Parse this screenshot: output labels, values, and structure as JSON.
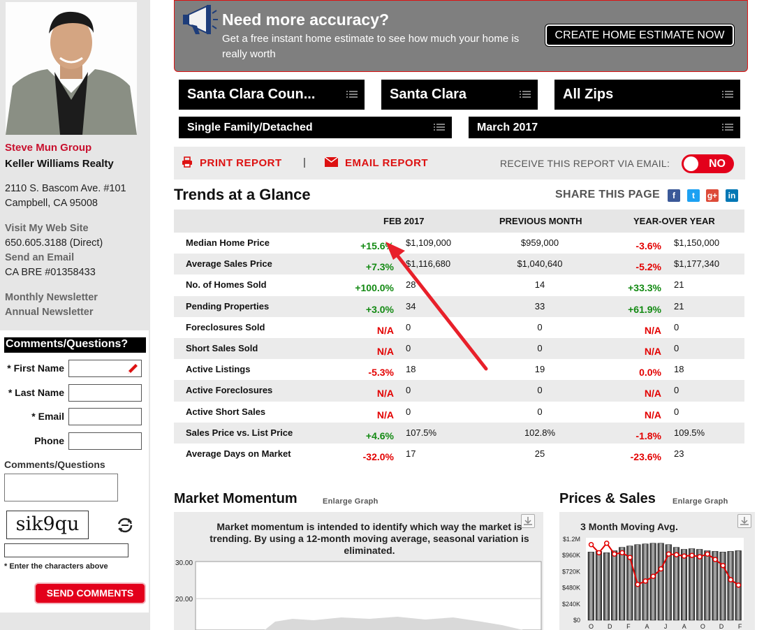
{
  "agent": {
    "name": "Steve Mun Group",
    "company": "Keller Williams Realty",
    "address1": "2110 S. Bascom Ave. #101",
    "address2": "Campbell, CA 95008",
    "website_link": "Visit My Web Site",
    "phone": "650.605.3188  (Direct)",
    "email_link": "Send an Email",
    "license": "CA BRE #01358433",
    "monthly_newsletter": "Monthly Newsletter",
    "annual_newsletter": "Annual Newsletter"
  },
  "form": {
    "title": "Comments/Questions?",
    "first_name_label": "* First Name",
    "last_name_label": "* Last Name",
    "email_label": "* Email",
    "phone_label": "Phone",
    "comments_label": "Comments/Questions",
    "captcha_text": "sik9qu",
    "captcha_note": "* Enter the characters above",
    "send_label": "SEND COMMENTS"
  },
  "banner": {
    "title": "Need more accuracy?",
    "subtitle": "Get a free instant home estimate to see how much your home is really worth",
    "button": "CREATE HOME ESTIMATE NOW"
  },
  "filters": {
    "county": "Santa Clara Coun...",
    "city": "Santa Clara",
    "zip": "All Zips",
    "property_type": "Single Family/Detached",
    "month": "March 2017"
  },
  "toolbar": {
    "print": "PRINT REPORT",
    "email": "EMAIL REPORT",
    "receive": "RECEIVE THIS REPORT VIA EMAIL:",
    "toggle": "NO"
  },
  "trends": {
    "title": "Trends at a Glance",
    "share": "SHARE THIS PAGE",
    "social": [
      "f",
      "t",
      "g+",
      "in"
    ],
    "colors": {
      "facebook": "#3b5998",
      "twitter": "#1da1f2",
      "google": "#dd4b39",
      "linkedin": "#0077b5",
      "positive": "#138a13",
      "negative": "#e30000",
      "accent": "#e3001b"
    },
    "headers": {
      "current": "FEB 2017",
      "previous": "PREVIOUS MONTH",
      "yoy": "YEAR-OVER YEAR"
    },
    "rows": [
      {
        "label": "Median Home Price",
        "pct": "+15.6%",
        "pct_type": "pos",
        "value": "$1,109,000",
        "prev": "$959,000",
        "yoy_pct": "-3.6%",
        "yoy_type": "neg",
        "yoy_value": "$1,150,000"
      },
      {
        "label": "Average Sales Price",
        "pct": "+7.3%",
        "pct_type": "pos",
        "value": "$1,116,680",
        "prev": "$1,040,640",
        "yoy_pct": "-5.2%",
        "yoy_type": "neg",
        "yoy_value": "$1,177,340"
      },
      {
        "label": "No. of Homes Sold",
        "pct": "+100.0%",
        "pct_type": "pos",
        "value": "28",
        "prev": "14",
        "yoy_pct": "+33.3%",
        "yoy_type": "pos",
        "yoy_value": "21"
      },
      {
        "label": "Pending Properties",
        "pct": "+3.0%",
        "pct_type": "pos",
        "value": "34",
        "prev": "33",
        "yoy_pct": "+61.9%",
        "yoy_type": "pos",
        "yoy_value": "21"
      },
      {
        "label": "Foreclosures Sold",
        "pct": "N/A",
        "pct_type": "neg",
        "value": "0",
        "prev": "0",
        "yoy_pct": "N/A",
        "yoy_type": "neg",
        "yoy_value": "0"
      },
      {
        "label": "Short Sales Sold",
        "pct": "N/A",
        "pct_type": "neg",
        "value": "0",
        "prev": "0",
        "yoy_pct": "N/A",
        "yoy_type": "neg",
        "yoy_value": "0"
      },
      {
        "label": "Active Listings",
        "pct": "-5.3%",
        "pct_type": "neg",
        "value": "18",
        "prev": "19",
        "yoy_pct": "0.0%",
        "yoy_type": "neg",
        "yoy_value": "18"
      },
      {
        "label": "Active Foreclosures",
        "pct": "N/A",
        "pct_type": "neg",
        "value": "0",
        "prev": "0",
        "yoy_pct": "N/A",
        "yoy_type": "neg",
        "yoy_value": "0"
      },
      {
        "label": "Active Short Sales",
        "pct": "N/A",
        "pct_type": "neg",
        "value": "0",
        "prev": "0",
        "yoy_pct": "N/A",
        "yoy_type": "neg",
        "yoy_value": "0"
      },
      {
        "label": "Sales Price vs. List Price",
        "pct": "+4.6%",
        "pct_type": "pos",
        "value": "107.5%",
        "prev": "102.8%",
        "yoy_pct": "-1.8%",
        "yoy_type": "neg",
        "yoy_value": "109.5%"
      },
      {
        "label": "Average Days on Market",
        "pct": "-32.0%",
        "pct_type": "neg",
        "value": "17",
        "prev": "25",
        "yoy_pct": "-23.6%",
        "yoy_type": "neg",
        "yoy_value": "23"
      }
    ]
  },
  "market_momentum": {
    "title": "Market Momentum",
    "enlarge": "Enlarge Graph",
    "description": "Market momentum is intended to identify which way the market is trending. By using a 12-month moving average, seasonal variation is eliminated.",
    "y_ticks": [
      "30.00",
      "20.00"
    ]
  },
  "prices_sales": {
    "title": "Prices & Sales",
    "enlarge": "Enlarge Graph",
    "subtitle": "3 Month Moving Avg."
  },
  "chart_data": [
    {
      "type": "area",
      "title": "Market Momentum",
      "ylim": [
        0,
        30
      ],
      "y_ticks": [
        20,
        30
      ],
      "grid": true
    },
    {
      "type": "bar",
      "title": "3 Month Moving Avg.",
      "y_ticks": [
        "$0",
        "$240K",
        "$480K",
        "$720K",
        "$960K",
        "$1.2M"
      ],
      "ylim": [
        0,
        1200000
      ],
      "x_ticks": [
        "O",
        "D",
        "F",
        "A",
        "J",
        "A",
        "O",
        "D",
        "F"
      ],
      "series": [
        {
          "values": [
            1010000,
            1020000,
            1000000,
            1030000,
            1080000,
            1100000,
            1120000,
            1130000,
            1140000,
            1140000,
            1120000,
            1080000,
            1050000,
            1060000,
            1050000,
            1030000,
            1020000,
            1010000,
            1020000,
            1030000
          ]
        },
        {
          "values": [
            1120000,
            1000000,
            1140000,
            980000,
            1000000,
            930000,
            530000,
            580000,
            650000,
            760000,
            980000,
            970000,
            950000,
            960000,
            940000,
            980000,
            900000,
            810000,
            600000,
            520000
          ]
        }
      ]
    }
  ]
}
